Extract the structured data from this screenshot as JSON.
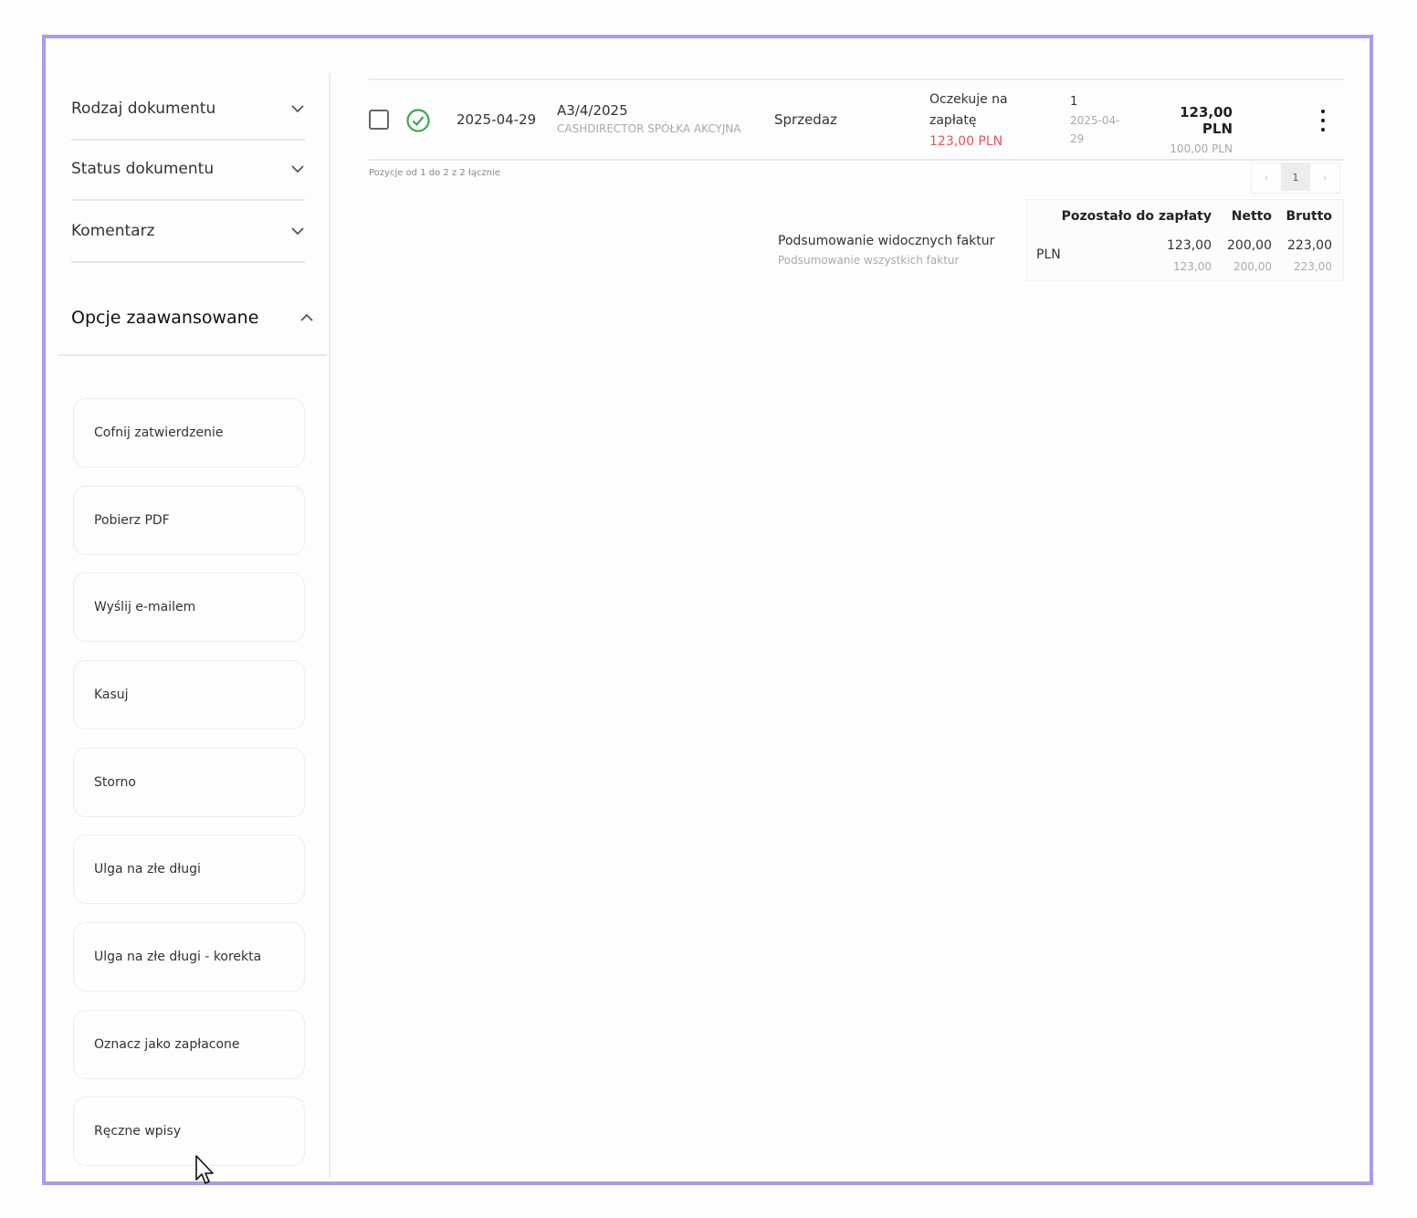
{
  "sidebar": {
    "filters": [
      {
        "label": "Rodzaj dokumentu"
      },
      {
        "label": "Status dokumentu"
      },
      {
        "label": "Komentarz"
      }
    ],
    "advanced_label": "Opcje zaawansowane",
    "options": [
      {
        "label": "Cofnij zatwierdzenie"
      },
      {
        "label": "Pobierz PDF"
      },
      {
        "label": "Wyślij e-mailem"
      },
      {
        "label": "Kasuj"
      },
      {
        "label": "Storno"
      },
      {
        "label": "Ulga na złe długi"
      },
      {
        "label": "Ulga na złe długi - korekta"
      },
      {
        "label": "Oznacz jako zapłacone"
      },
      {
        "label": "Ręczne wpisy"
      }
    ]
  },
  "invoice": {
    "date": "2025-04-29",
    "number": "A3/4/2025",
    "company": "CASHDIRECTOR SPÓŁKA AKCYJNA",
    "type": "Sprzedaz",
    "status_line1": "Oczekuje na",
    "status_line2": "zapłatę",
    "remaining": "123,00 PLN",
    "count": "1",
    "due_line1": "2025-04-",
    "due_line2": "29",
    "amount_gross": "123,00 PLN",
    "amount_net": "100,00 PLN"
  },
  "pagination": {
    "info": "Pozycje od 1 do 2 z 2 łącznie",
    "prev": "‹",
    "current": "1",
    "next": "›"
  },
  "summary": {
    "visible_label": "Podsumowanie widocznych faktur",
    "all_label": "Podsumowanie wszystkich faktur",
    "headers": {
      "remaining": "Pozostało do zapłaty",
      "net": "Netto",
      "gross": "Brutto"
    },
    "currency": "PLN",
    "visible": {
      "remaining": "123,00",
      "net": "200,00",
      "gross": "223,00"
    },
    "all": {
      "remaining": "123,00",
      "net": "200,00",
      "gross": "223,00"
    }
  },
  "colors": {
    "frame": "#a99cf0",
    "status_ok": "#3aaa4a",
    "remaining_red": "#e05561"
  }
}
